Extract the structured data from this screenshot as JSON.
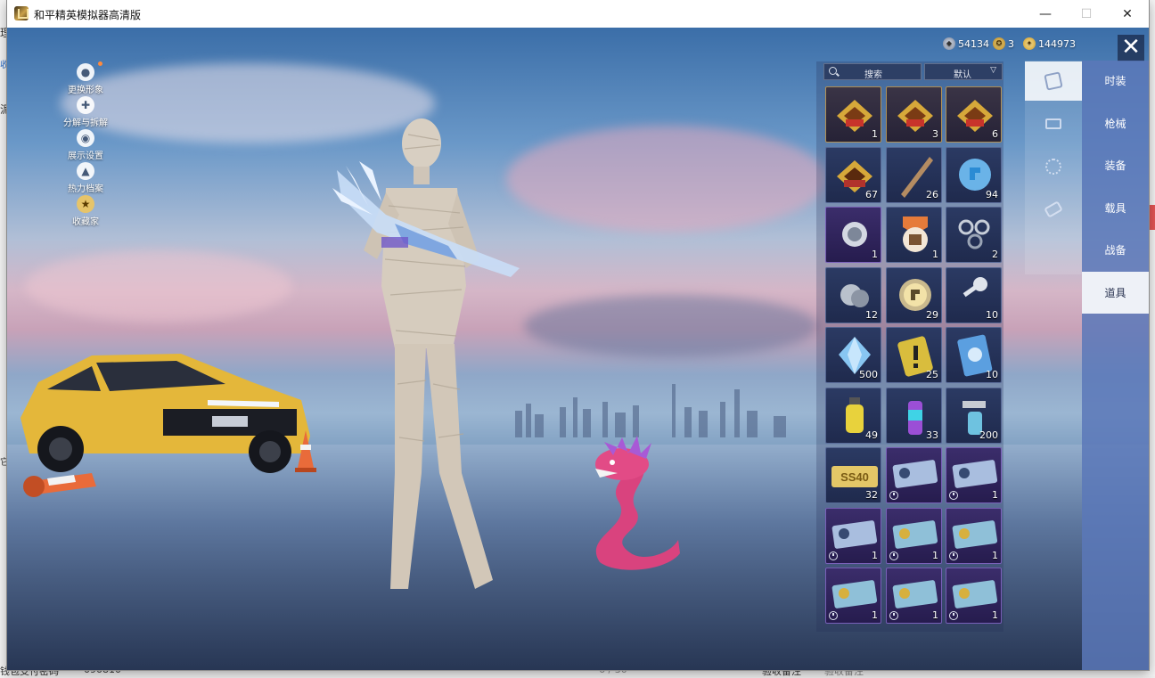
{
  "window": {
    "title": "和平精英模拟器高清版",
    "minimize_glyph": "—",
    "maximize_glyph": "☐",
    "close_glyph": "✕"
  },
  "background_page": {
    "left_fragments": [
      "理",
      "收",
      "泥",
      "它"
    ],
    "bottom_left": "钱包支付密码",
    "bottom_value": "090810",
    "bottom_page": "6 / 30",
    "bottom_right_1": "验收备注",
    "bottom_right_2": "验收备注"
  },
  "currencies": [
    {
      "icon": "silver-coin-icon",
      "value": "54134"
    },
    {
      "icon": "uc-icon",
      "value": "3"
    },
    {
      "icon": "gold-coin-icon",
      "value": "144973"
    }
  ],
  "side_menu": [
    {
      "label": "更换形象",
      "icon": "person-icon",
      "badge": true
    },
    {
      "label": "分解与拆解",
      "icon": "puzzle-icon",
      "badge": false
    },
    {
      "label": "展示设置",
      "icon": "eye-icon",
      "badge": false
    },
    {
      "label": "热力档案",
      "icon": "flame-icon",
      "badge": false
    },
    {
      "label": "收藏家",
      "icon": "collector-badge-icon",
      "badge": false
    }
  ],
  "inventory": {
    "search_label": "搜索",
    "sort_label": "默认",
    "items": [
      {
        "kind": "card-3day",
        "count": "1",
        "style": "gold"
      },
      {
        "kind": "card-1day",
        "count": "3",
        "style": "gold"
      },
      {
        "kind": "card-3day",
        "count": "6",
        "style": "gold"
      },
      {
        "kind": "card-2hour",
        "count": "67",
        "style": "blue"
      },
      {
        "kind": "stick",
        "count": "26",
        "style": "blue"
      },
      {
        "kind": "puzzle-orb",
        "count": "94",
        "style": "blue"
      },
      {
        "kind": "coin-badge",
        "count": "1",
        "style": "purple"
      },
      {
        "kind": "crate-medal",
        "count": "1",
        "style": "blue"
      },
      {
        "kind": "ring-set",
        "count": "2",
        "style": "blue"
      },
      {
        "kind": "metal-parts",
        "count": "12",
        "style": "blue"
      },
      {
        "kind": "puzzle-coin",
        "count": "29",
        "style": "blue"
      },
      {
        "kind": "key",
        "count": "10",
        "style": "blue"
      },
      {
        "kind": "diamond",
        "count": "500",
        "style": "blue"
      },
      {
        "kind": "alert-card",
        "count": "25",
        "style": "blue"
      },
      {
        "kind": "gear-card",
        "count": "10",
        "style": "blue"
      },
      {
        "kind": "yellow-grenade",
        "count": "49",
        "style": "blue"
      },
      {
        "kind": "spray-can",
        "count": "33",
        "style": "blue"
      },
      {
        "kind": "spray-gun",
        "count": "200",
        "style": "blue"
      },
      {
        "kind": "ss40-ticket",
        "count": "32",
        "style": "blue"
      },
      {
        "kind": "voucher",
        "count": "",
        "style": "purple",
        "timer": true
      },
      {
        "kind": "voucher",
        "count": "1",
        "style": "purple",
        "timer": true
      },
      {
        "kind": "voucher",
        "count": "1",
        "style": "purple",
        "timer": true
      },
      {
        "kind": "voucher-gold",
        "count": "1",
        "style": "purple",
        "timer": true
      },
      {
        "kind": "voucher-gold",
        "count": "1",
        "style": "purple",
        "timer": true
      },
      {
        "kind": "voucher-gold",
        "count": "1",
        "style": "purple",
        "timer": true
      },
      {
        "kind": "voucher-gold",
        "count": "1",
        "style": "purple",
        "timer": true
      },
      {
        "kind": "voucher-gold",
        "count": "1",
        "style": "purple",
        "timer": true
      }
    ],
    "ticket_text": "SS40"
  },
  "tab_icons": [
    "card-tab-icon",
    "crate-tab-icon",
    "firework-tab-icon",
    "ticket-tab-icon"
  ],
  "categories": [
    "时装",
    "枪械",
    "装备",
    "载具",
    "战备",
    "道具"
  ],
  "active_category": "道具",
  "colors": {
    "accent_panel": "#5a78b9",
    "active_tab": "#eef1f7"
  }
}
